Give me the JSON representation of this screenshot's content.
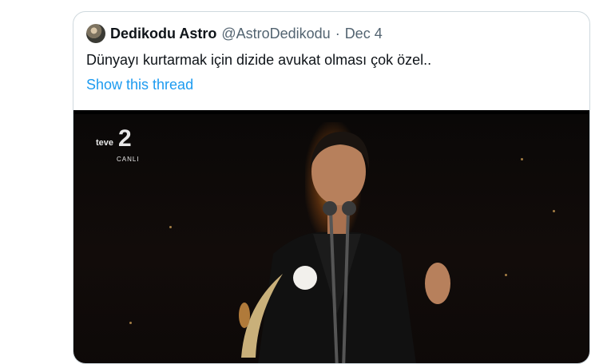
{
  "tweet": {
    "author_name": "Dedikodu Astro",
    "author_handle": "@AstroDedikodu",
    "separator": "·",
    "date": "Dec 4",
    "text": "Dünyayı kurtarmak için dizide avukat olması çok özel..",
    "show_thread": "Show this thread"
  },
  "media": {
    "channel_name": "teve",
    "channel_number": "2",
    "channel_live": "CANLI"
  },
  "colors": {
    "link": "#1d9bf0",
    "secondary_text": "#536471",
    "border": "#cfd9de"
  }
}
